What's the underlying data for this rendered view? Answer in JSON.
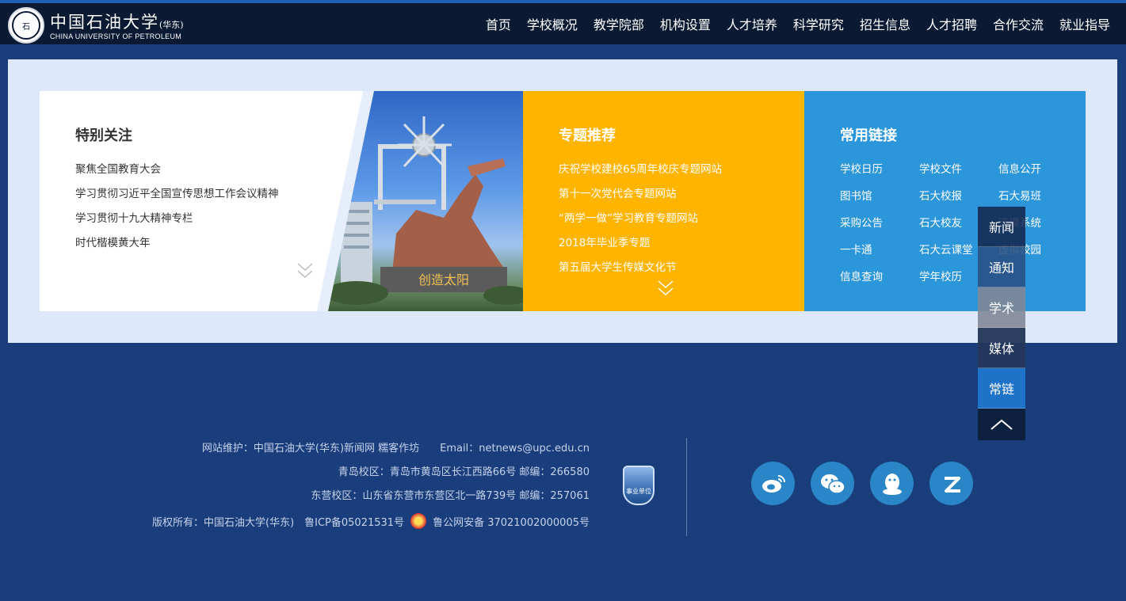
{
  "header": {
    "brand_cn": "中国石油大学",
    "brand_cn_sub": "(华东)",
    "brand_en": "CHINA UNIVERSITY OF PETROLEUM",
    "nav": [
      "首页",
      "学校概况",
      "教学院部",
      "机构设置",
      "人才培养",
      "科学研究",
      "招生信息",
      "人才招聘",
      "合作交流",
      "就业指导"
    ]
  },
  "special": {
    "title": "特别关注",
    "items": [
      "聚焦全国教育大会",
      "学习贯彻习近平全国宣传思想工作会议精神",
      "学习贯彻十九大精神专栏",
      "时代楷模黄大年"
    ]
  },
  "photo": {
    "caption": "创造太阳"
  },
  "topics": {
    "title": "专题推荐",
    "items": [
      "庆祝学校建校65周年校庆专题网站",
      "第十一次党代会专题网站",
      "“两学一做”学习教育专题网站",
      "2018年毕业季专题",
      "第五届大学生传媒文化节"
    ]
  },
  "links": {
    "title": "常用链接",
    "items": [
      "学校日历",
      "学校文件",
      "信息公开",
      "图书馆",
      "石大校报",
      "石大易班",
      "采购公告",
      "石大校友",
      "选课系统",
      "一卡通",
      "石大云课堂",
      "虚拟校园",
      "信息查询",
      "学年校历"
    ]
  },
  "side_nav": [
    "新闻",
    "通知",
    "学术",
    "媒体",
    "常链"
  ],
  "footer": {
    "line1": "网站维护：中国石油大学(华东)新闻网 糯客作坊　　Email：netnews@upc.edu.cn",
    "line2": "青岛校区：青岛市黄岛区长江西路66号 邮编：266580",
    "line3": "东营校区：山东省东营市东营区北一路739号 邮编：257061",
    "line4a": "版权所有：中国石油大学(华东)　鲁ICP备05021531号",
    "line4b": "鲁公网安备 37021002000005号",
    "badge": "事业单位"
  },
  "colors": {
    "header_bg": "#0b1a33",
    "page_bg": "#1a3d7c",
    "yellow": "#ffb400",
    "blue": "#2b96d9",
    "side_active": "#1e73c9"
  }
}
